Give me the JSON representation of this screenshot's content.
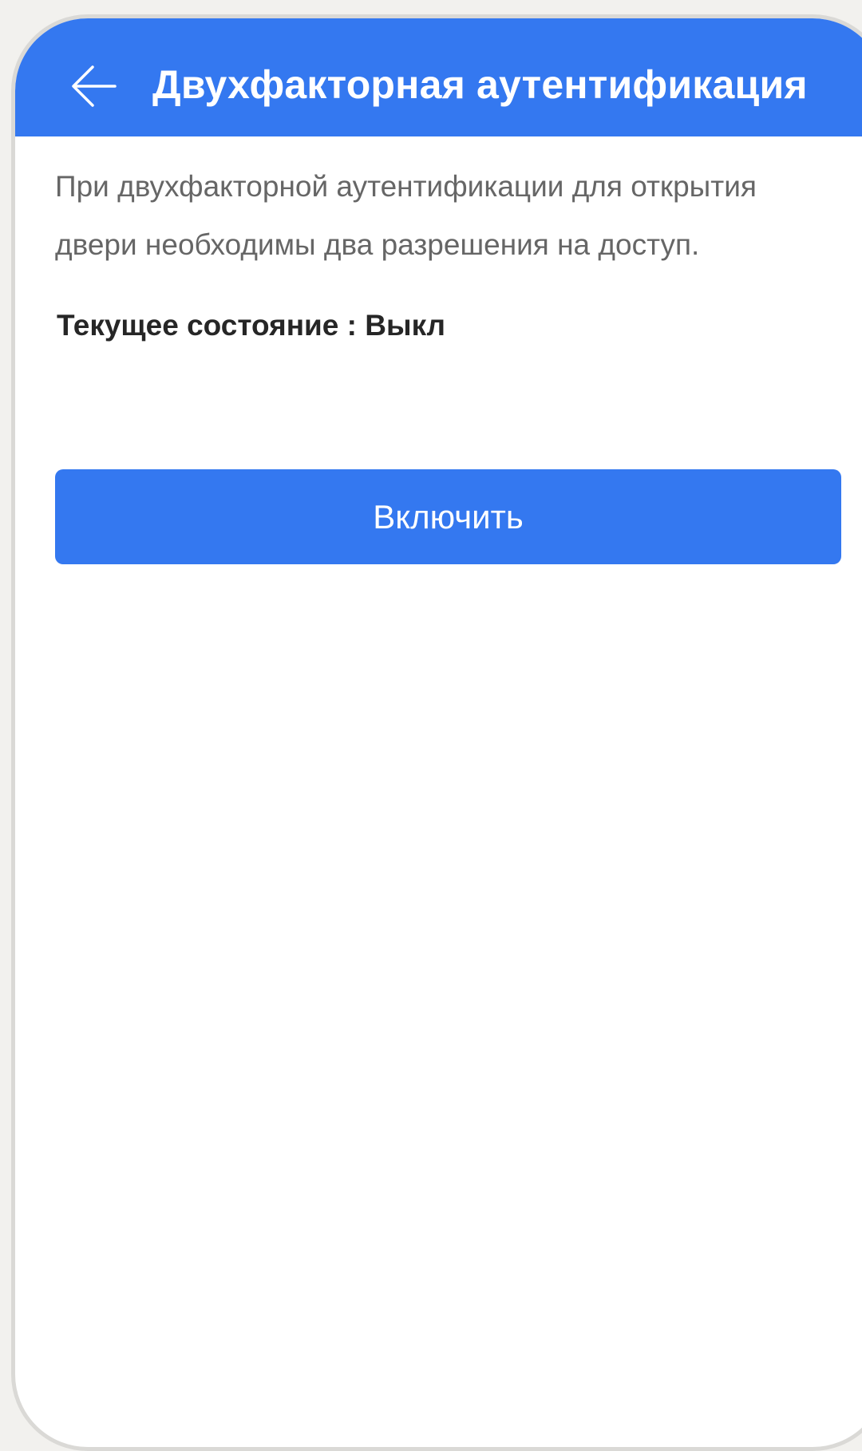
{
  "header": {
    "back_icon": "arrow-left-icon",
    "title": "Двухфакторная аутентификация"
  },
  "main": {
    "description": "При двухфакторной аутентификации для открытия двери необходимы два разрешения на доступ.",
    "status_label": "Текущее состояние",
    "status_separator": " : ",
    "status_value": "Выкл",
    "enable_button_label": "Включить"
  },
  "colors": {
    "accent": "#3478f0",
    "background": "#ffffff",
    "description_text": "#666666",
    "status_text": "#262626",
    "outer_background": "#f2f1ee"
  }
}
